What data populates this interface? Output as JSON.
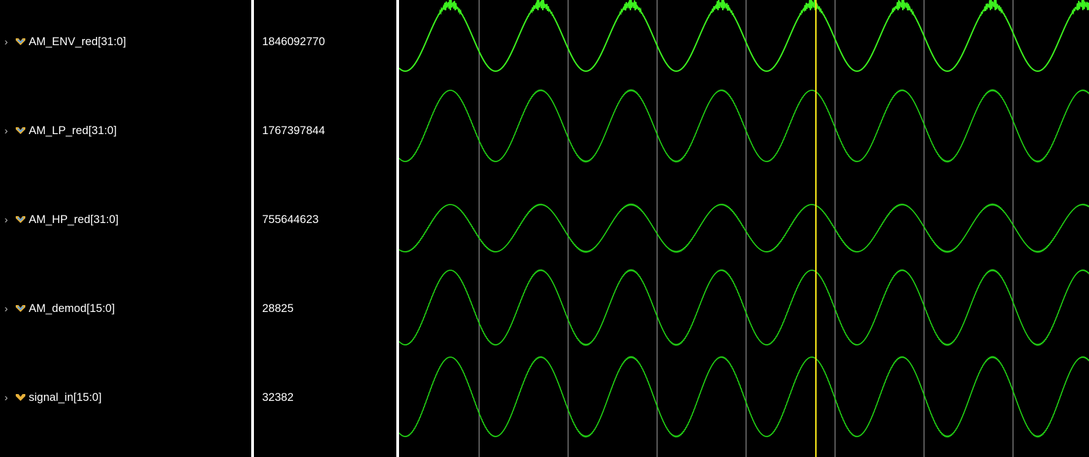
{
  "colors": {
    "background": "#000000",
    "divider": "#ffffff",
    "waveform": "#22d414",
    "waveform_bright": "#3cf01e",
    "gridline": "#6e6e6e",
    "cursor": "#f2e21a",
    "text": "#ffffff"
  },
  "signals": [
    {
      "name": "AM_ENV_red[31:0]",
      "value": "1846092770",
      "icon": "bus-vector-icon",
      "expanded": false
    },
    {
      "name": "AM_LP_red[31:0]",
      "value": "1767397844",
      "icon": "bus-vector-icon",
      "expanded": false
    },
    {
      "name": "AM_HP_red[31:0]",
      "value": "755644623",
      "icon": "bus-vector-icon",
      "expanded": false
    },
    {
      "name": "AM_demod[15:0]",
      "value": "28825",
      "icon": "bus-vector-icon",
      "expanded": false
    },
    {
      "name": "signal_in[15:0]",
      "value": "32382",
      "icon": "bus-vector-icon",
      "expanded": false
    }
  ],
  "waveform": {
    "display": "analog",
    "cycles_visible": 7.6,
    "gridline_count": 7,
    "cursor_present": true
  }
}
